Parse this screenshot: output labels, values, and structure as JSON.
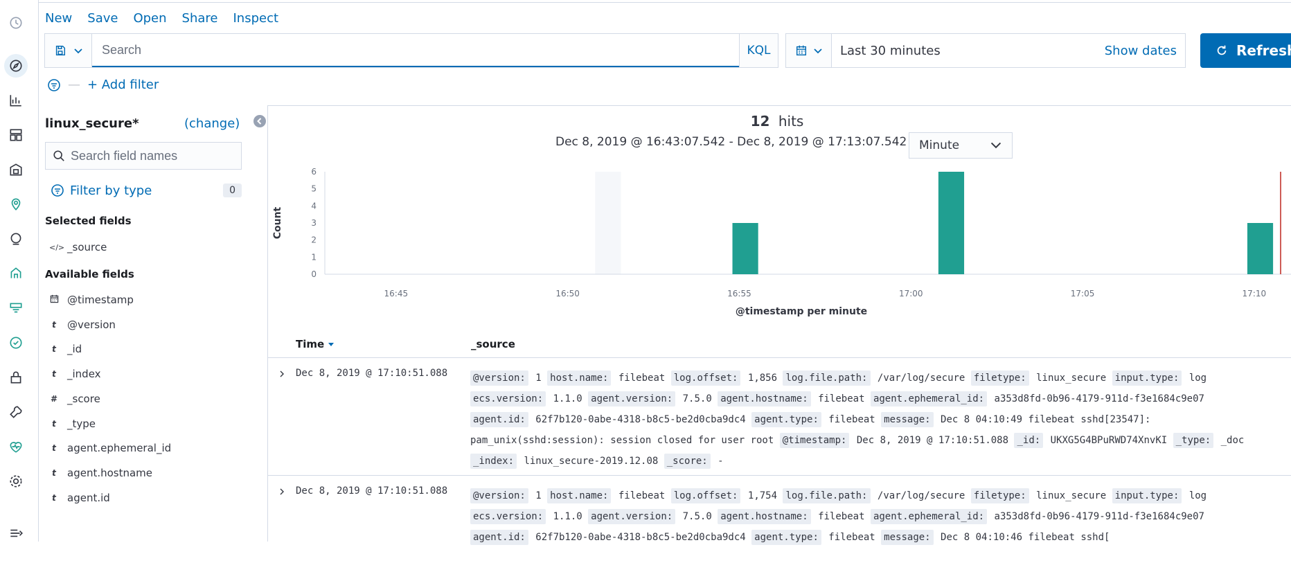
{
  "topmenu": {
    "new": "New",
    "save": "Save",
    "open": "Open",
    "share": "Share",
    "inspect": "Inspect"
  },
  "query": {
    "placeholder": "Search",
    "language": "KQL"
  },
  "timepicker": {
    "range": "Last 30 minutes",
    "show_dates": "Show dates",
    "refresh": "Refresh"
  },
  "filters": {
    "dash": "—",
    "add_filter": "+ Add filter"
  },
  "sidebar": {
    "index_pattern": "linux_secure*",
    "change": "(change)",
    "search_placeholder": "Search field names",
    "filter_by_type": "Filter by type",
    "filter_count": "0",
    "selected_heading": "Selected fields",
    "selected_fields": [
      {
        "type": "</>",
        "name": "_source"
      }
    ],
    "available_heading": "Available fields",
    "available_fields": [
      {
        "type": "cal",
        "name": "@timestamp"
      },
      {
        "type": "t",
        "name": "@version"
      },
      {
        "type": "t",
        "name": "_id"
      },
      {
        "type": "t",
        "name": "_index"
      },
      {
        "type": "#",
        "name": "_score"
      },
      {
        "type": "t",
        "name": "_type"
      },
      {
        "type": "t",
        "name": "agent.ephemeral_id"
      },
      {
        "type": "t",
        "name": "agent.hostname"
      },
      {
        "type": "t",
        "name": "agent.id"
      }
    ]
  },
  "results": {
    "hits_count": "12",
    "hits_label": "hits",
    "time_range": "Dec 8, 2019 @ 16:43:07.542 - Dec 8, 2019 @ 17:13:07.542 —",
    "interval": "Minute"
  },
  "chart_data": {
    "type": "bar",
    "title": "",
    "xlabel": "@timestamp per minute",
    "ylabel": "Count",
    "x_ticks": [
      "16:45",
      "16:50",
      "16:55",
      "17:00",
      "17:05",
      "17:10"
    ],
    "y_ticks": [
      0,
      1,
      2,
      3,
      4,
      5,
      6
    ],
    "ylim": [
      0,
      6
    ],
    "bars": [
      {
        "time": "16:55",
        "value": 3
      },
      {
        "time": "17:01",
        "value": 6
      },
      {
        "time": "17:10",
        "value": 3
      }
    ],
    "highlight_band": "16:51",
    "bar_color": "#209f91"
  },
  "table": {
    "col_time": "Time",
    "col_source": "_source",
    "rows": [
      {
        "time": "Dec 8, 2019 @ 17:10:51.088",
        "lines": [
          [
            [
              "@version:",
              "1"
            ],
            [
              "host.name:",
              "filebeat"
            ],
            [
              "log.offset:",
              "1,856"
            ],
            [
              "log.file.path:",
              "/var/log/secure"
            ],
            [
              "filetype:",
              "linux_secure"
            ],
            [
              "input.type:",
              "log"
            ]
          ],
          [
            [
              "ecs.version:",
              "1.1.0"
            ],
            [
              "agent.version:",
              "7.5.0"
            ],
            [
              "agent.hostname:",
              "filebeat"
            ],
            [
              "agent.ephemeral_id:",
              "a353d8fd-0b96-4179-911d-f3e1684c9e07"
            ]
          ],
          [
            [
              "agent.id:",
              "62f7b120-0abe-4318-b8c5-be2d0cba9dc4"
            ],
            [
              "agent.type:",
              "filebeat"
            ],
            [
              "message:",
              "Dec 8 04:10:49 filebeat sshd[23547]:"
            ]
          ],
          [
            [
              "",
              "pam_unix(sshd:session): session closed for user root"
            ],
            [
              "@timestamp:",
              "Dec 8, 2019 @ 17:10:51.088"
            ],
            [
              "_id:",
              "UKXG5G4BPuRWD74XnvKI"
            ],
            [
              "_type:",
              "_doc"
            ]
          ],
          [
            [
              "_index:",
              "linux_secure-2019.12.08"
            ],
            [
              "_score:",
              " -"
            ]
          ]
        ]
      },
      {
        "time": "Dec 8, 2019 @ 17:10:51.088",
        "lines": [
          [
            [
              "@version:",
              "1"
            ],
            [
              "host.name:",
              "filebeat"
            ],
            [
              "log.offset:",
              "1,754"
            ],
            [
              "log.file.path:",
              "/var/log/secure"
            ],
            [
              "filetype:",
              "linux_secure"
            ],
            [
              "input.type:",
              "log"
            ]
          ],
          [
            [
              "ecs.version:",
              "1.1.0"
            ],
            [
              "agent.version:",
              "7.5.0"
            ],
            [
              "agent.hostname:",
              "filebeat"
            ],
            [
              "agent.ephemeral_id:",
              "a353d8fd-0b96-4179-911d-f3e1684c9e07"
            ]
          ],
          [
            [
              "agent.id:",
              "62f7b120-0abe-4318-b8c5-be2d0cba9dc4"
            ],
            [
              "agent.type:",
              "filebeat"
            ],
            [
              "message:",
              "Dec 8 04:10:46 filebeat sshd["
            ]
          ]
        ]
      }
    ]
  }
}
